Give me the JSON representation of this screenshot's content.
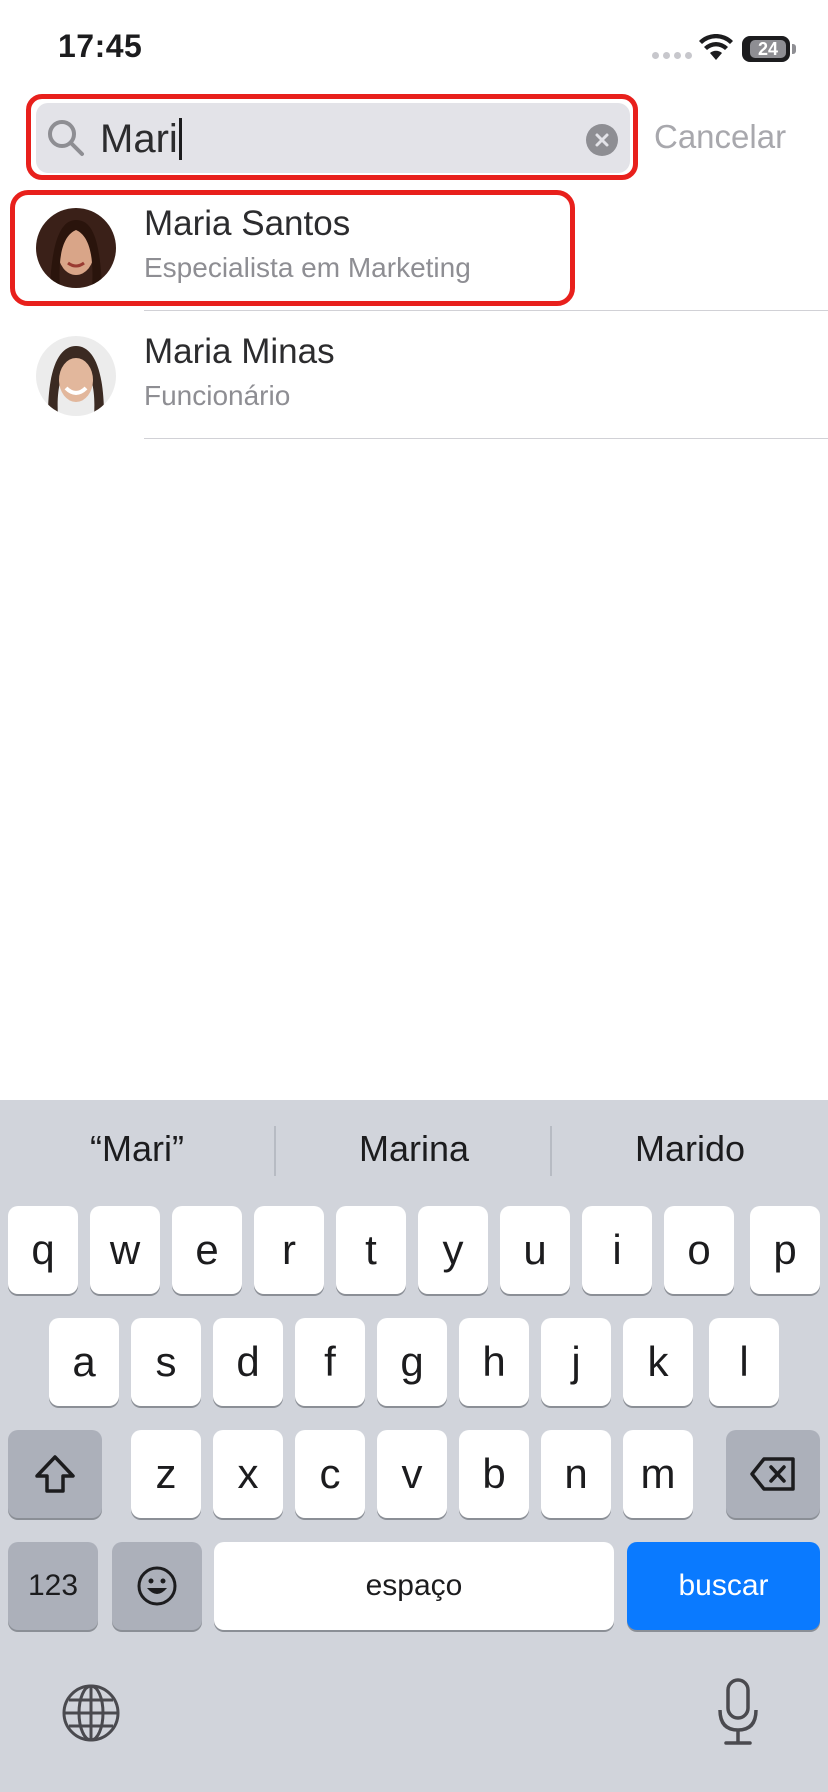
{
  "status_bar": {
    "time": "17:45",
    "battery": "24"
  },
  "search": {
    "query": "Mari",
    "cancel_label": "Cancelar"
  },
  "results": [
    {
      "name": "Maria Santos",
      "subtitle": "Especialista em Marketing"
    },
    {
      "name": "Maria Minas",
      "subtitle": "Funcionário"
    }
  ],
  "keyboard": {
    "suggestions": [
      "“Mari”",
      "Marina",
      "Marido"
    ],
    "row1": [
      "q",
      "w",
      "e",
      "r",
      "t",
      "y",
      "u",
      "i",
      "o",
      "p"
    ],
    "row2": [
      "a",
      "s",
      "d",
      "f",
      "g",
      "h",
      "j",
      "k",
      "l"
    ],
    "row3": [
      "z",
      "x",
      "c",
      "v",
      "b",
      "n",
      "m"
    ],
    "numbers_label": "123",
    "space_label": "espaço",
    "search_label": "buscar",
    "icons": {
      "shift": "shift-icon",
      "delete": "delete-icon",
      "emoji": "emoji-icon",
      "globe": "globe-icon",
      "mic": "microphone-icon"
    }
  },
  "colors": {
    "highlight": "#e8201c",
    "accent": "#0a7aff"
  }
}
